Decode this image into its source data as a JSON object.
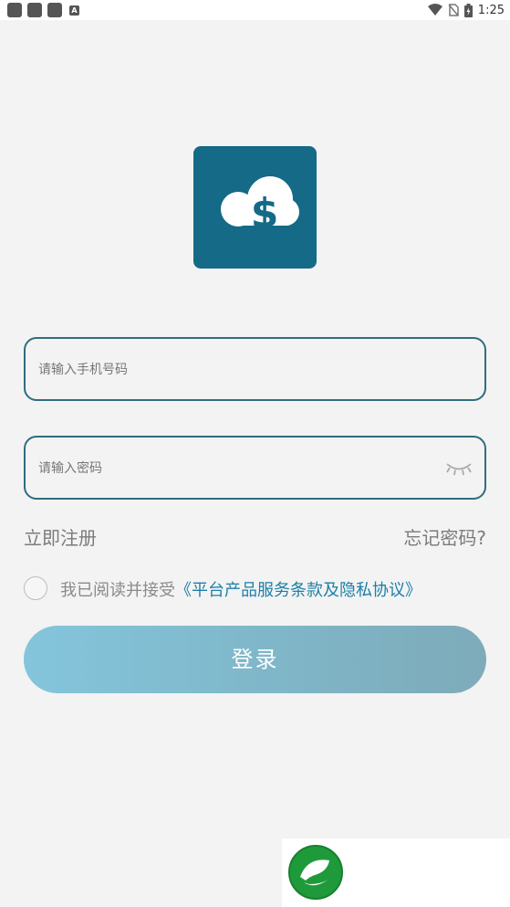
{
  "status_bar": {
    "time": "1:25",
    "left_icons": [
      "notification-icon",
      "notification-icon",
      "notification-icon",
      "a-badge-icon"
    ],
    "right_icons": [
      "wifi-icon",
      "no-sim-icon",
      "battery-charging-icon"
    ]
  },
  "logo": {
    "icon": "cloud-dollar-icon",
    "color": "#146a87"
  },
  "login_form": {
    "phone_placeholder": "请输入手机号码",
    "password_placeholder": "请输入密码",
    "password_toggle_icon": "eye-closed-icon",
    "register_label": "立即注册",
    "forgot_label": "忘记密码?",
    "agreement_prefix": "我已阅读并接受",
    "agreement_link": "《平台产品服务条款及隐私协议》",
    "login_label": "登录"
  },
  "colors": {
    "accent": "#2f6d7f",
    "link": "#1d7fa7",
    "button_gradient_start": "#84c5dc",
    "button_gradient_end": "#7eabba"
  },
  "brand_badge": {
    "icon": "green-leaf-logo-icon"
  }
}
